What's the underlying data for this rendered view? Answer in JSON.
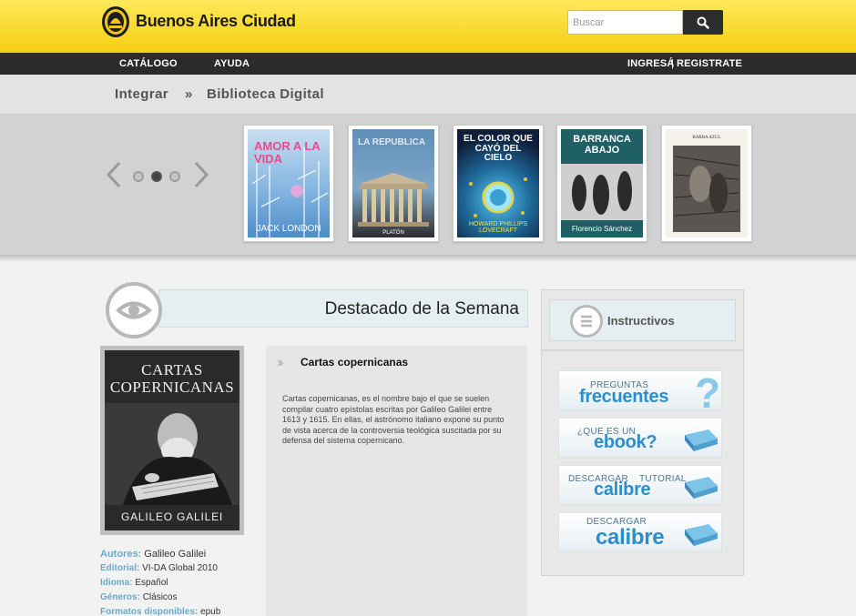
{
  "header": {
    "brand": "Buenos Aires Ciudad",
    "search_placeholder": "Buscar"
  },
  "nav": {
    "left": [
      "CATÁLOGO",
      "AYUDA"
    ],
    "login": "INGRESÁ",
    "separator": "|",
    "register": "REGISTRATE"
  },
  "breadcrumb": {
    "items": [
      "Integrar",
      "Biblioteca Digital"
    ],
    "separator": "»"
  },
  "carousel": {
    "active_page": 2,
    "pages": 3,
    "books": [
      {
        "title": "AMOR A LA VIDA",
        "author": "JACK LONDON"
      },
      {
        "title": "LA REPUBLICA",
        "author": "PLATÓN"
      },
      {
        "title": "EL COLOR QUE CAYÓ DEL CIELO",
        "author": "HOWARD PHILLIPS LOVECRAFT"
      },
      {
        "title": "BARRANCA ABAJO",
        "author": "Florencio Sánchez"
      },
      {
        "title": "BARBA AZUL",
        "author": ""
      }
    ]
  },
  "featured": {
    "section_title": "Destacado de la Semana",
    "cover_title_line1": "CARTAS",
    "cover_title_line2": "COPERNICANAS",
    "cover_author": "GALILEO GALILEI",
    "book_title": "Cartas copernicanas",
    "description": "Cartas copernicanas, es el nombre bajo el que se suelen compilar cuatro epístolas escritas por Galileo Galilei entre 1613 y 1615. En ellas, el astrónomo italiano expone su punto de vista acerca de la controversia teológica suscitada por su defensa del sistema copernicano.",
    "meta": [
      {
        "key": "Autores:",
        "value": "Galileo Galilei"
      },
      {
        "key": "Editorial:",
        "value": "VI-DA Global 2010"
      },
      {
        "key": "Idioma:",
        "value": "Español"
      },
      {
        "key": "Géneros:",
        "value": "Clásicos"
      },
      {
        "key": "Formatos disponibles:",
        "value": "epub"
      }
    ]
  },
  "sidebar": {
    "instructivos": "Instructivos",
    "banners": [
      {
        "small": "PREGUNTAS",
        "big": "frecuentes"
      },
      {
        "small": "¿QUE ES UN",
        "big": "ebook?"
      },
      {
        "small": "DESCARGAR",
        "small2": "TUTORIAL",
        "big": "calibre"
      },
      {
        "small": "DESCARGAR",
        "big": "calibre"
      }
    ]
  },
  "colors": {
    "header_yellow": "#f7d21a",
    "nav_dark": "#2b2b2b",
    "accent_blue": "#2b8fcb",
    "meta_key_blue": "#6aa9c9"
  }
}
